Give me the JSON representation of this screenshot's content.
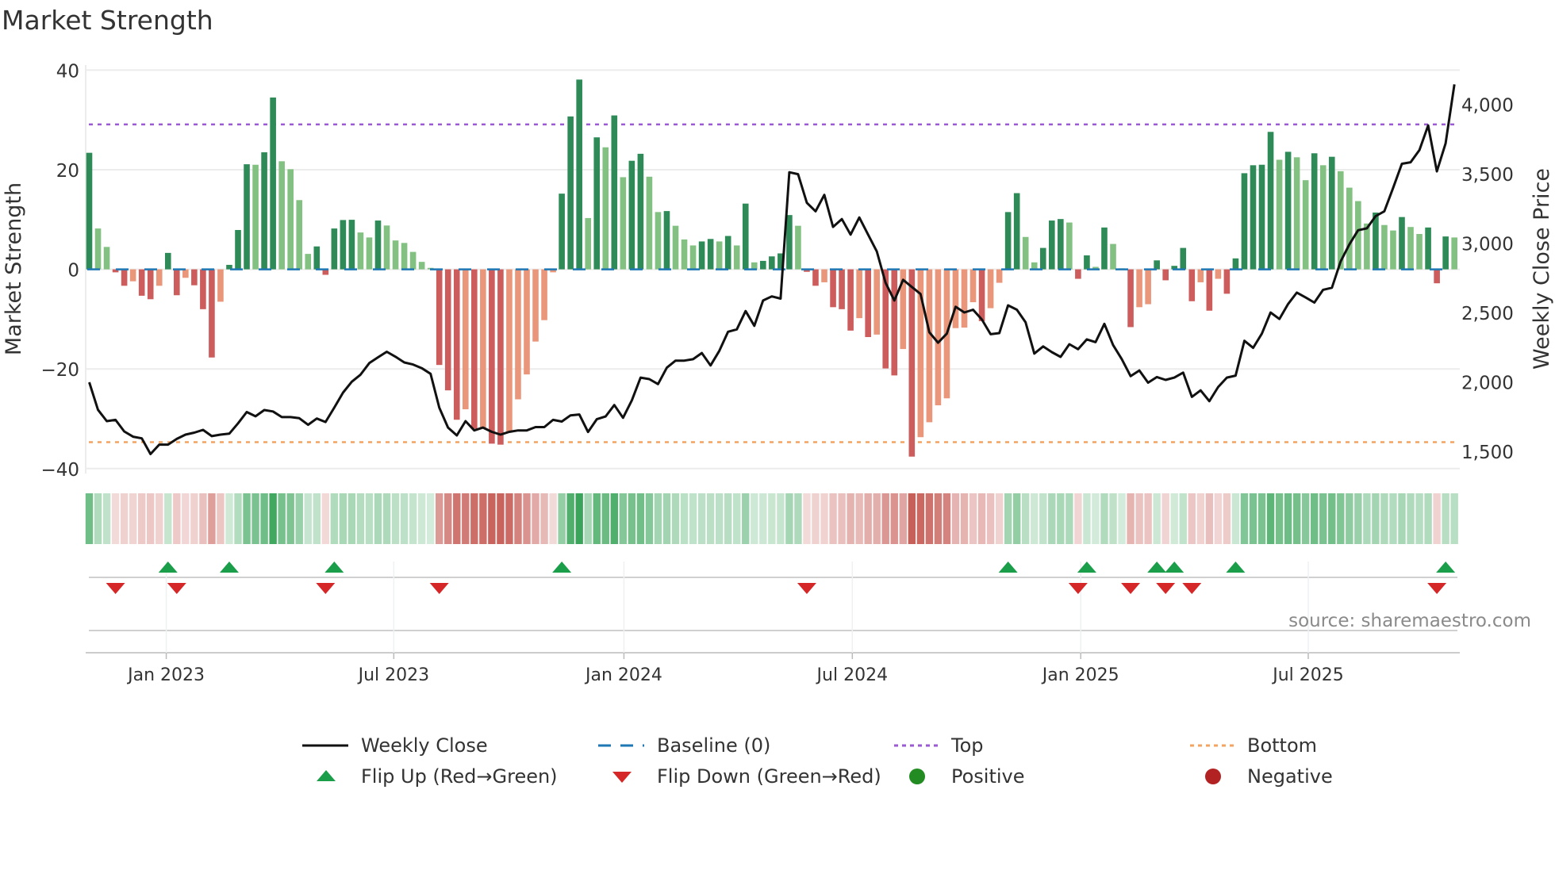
{
  "title": "Market Strength",
  "source": "source: sharemaestro.com",
  "colors": {
    "pos_dark": "#2e8b57",
    "pos_light": "#82c182",
    "neg_dark": "#cd5c5c",
    "neg_light": "#e9967a",
    "close": "#111111",
    "baseline": "#1f77b4",
    "top": "#9b59d6",
    "bottom": "#f4a460",
    "flip_up": "#1a9e4a",
    "flip_down": "#d62728",
    "positive": "#228b22",
    "negative": "#b22222",
    "strip_pos": "#3aa55a",
    "strip_neg": "#c8605a"
  },
  "legend": [
    {
      "label": "Weekly Close",
      "kind": "line"
    },
    {
      "label": "Baseline (0)",
      "kind": "dash"
    },
    {
      "label": "Top",
      "kind": "dot-top"
    },
    {
      "label": "Bottom",
      "kind": "dot-bottom"
    },
    {
      "label": "Flip Up (Red→Green)",
      "kind": "tri-up"
    },
    {
      "label": "Flip Down (Green→Red)",
      "kind": "tri-down"
    },
    {
      "label": "Positive",
      "kind": "dot-pos"
    },
    {
      "label": "Negative",
      "kind": "dot-neg"
    }
  ],
  "chart_data": {
    "type": "bar",
    "title": "Market Strength",
    "xlabel": "",
    "ylabel": "Market Strength",
    "ylabel_right": "Weekly Close Price",
    "ylim": [
      -40,
      40
    ],
    "ylim_right": [
      1500,
      4000
    ],
    "yticks": [
      "40",
      "20",
      "0",
      "−20",
      "−40"
    ],
    "ytick_values": [
      40,
      20,
      0,
      -20,
      -40
    ],
    "yticks_right": [
      "4,000",
      "3,500",
      "3,000",
      "2,500",
      "2,000",
      "1,500"
    ],
    "ytick_right_values": [
      4000,
      3500,
      3000,
      2500,
      2000,
      1500
    ],
    "x_unit": "week index (weekly bars, ~Nov 2022 to Oct 2025)",
    "xticks": [
      {
        "label": "Jan 2023",
        "week": 8.8
      },
      {
        "label": "Jul 2023",
        "week": 34.8
      },
      {
        "label": "Jan 2024",
        "week": 61.1
      },
      {
        "label": "Jul 2024",
        "week": 87.2
      },
      {
        "label": "Jan 2025",
        "week": 113.3
      },
      {
        "label": "Jul 2025",
        "week": 139.3
      }
    ],
    "top_level": 29.1,
    "bottom_level": -34.7,
    "baseline": 0,
    "series": [
      {
        "name": "Market Strength",
        "type": "bar",
        "values": [
          23.4,
          8.2,
          4.5,
          -0.6,
          -3.3,
          -2.4,
          -5.3,
          -6,
          -3.3,
          3.3,
          -5.2,
          -1.7,
          -3.2,
          -8,
          -17.7,
          -6.5,
          0.9,
          7.9,
          21.1,
          21,
          23.5,
          34.5,
          21.7,
          20.1,
          13.9,
          3.1,
          4.6,
          -1.1,
          8.2,
          9.9,
          9.95,
          7.4,
          6.4,
          9.8,
          8.8,
          5.8,
          5.3,
          3.5,
          1.5,
          0.3,
          -19.2,
          -24.3,
          -30.2,
          -28.1,
          -32,
          -31.9,
          -35,
          -35.2,
          -32.8,
          -26.1,
          -21.1,
          -14.5,
          -10.2,
          -0.6,
          15.2,
          30.7,
          38.1,
          10.3,
          26.5,
          24.5,
          30.9,
          18.5,
          21.8,
          23.2,
          18.6,
          11.5,
          11.7,
          8.75,
          6.0,
          4.8,
          5.6,
          6.1,
          5.6,
          6.7,
          4.8,
          13.2,
          1.4,
          1.7,
          2.6,
          3.2,
          10.9,
          8.75,
          -0.5,
          -3.3,
          -2.6,
          -7.6,
          -8,
          -12.3,
          -9.8,
          -13.6,
          -13.1,
          -19.9,
          -21.3,
          -16,
          -37.6,
          -33.7,
          -30.7,
          -27.3,
          -25.9,
          -11.8,
          -11.7,
          -6.6,
          -10.4,
          -7.8,
          -2.7,
          11.5,
          15.3,
          6.5,
          1.4,
          4.3,
          9.8,
          10.1,
          9.4,
          -1.9,
          2.8,
          0.5,
          8.4,
          5.1,
          0.2,
          -11.6,
          -7.6,
          -7,
          1.8,
          -2.2,
          0.7,
          4.3,
          -6.4,
          -2.6,
          -8.3,
          -1.9,
          -4.9,
          2.2,
          19.3,
          20.9,
          21,
          27.6,
          22,
          23.6,
          22.5,
          17.9,
          23.3,
          20.9,
          22.6,
          19.7,
          16.4,
          13.7,
          9.2,
          11.4,
          8.9,
          7.8,
          10.5,
          8.5,
          7.1,
          8.4,
          -2.8,
          6.6,
          6.4
        ]
      },
      {
        "name": "Weekly Close",
        "type": "line",
        "axis": "right",
        "values": [
          1997,
          1799,
          1717,
          1726,
          1643,
          1605,
          1593,
          1480,
          1548,
          1548,
          1589,
          1620,
          1634,
          1654,
          1609,
          1620,
          1627,
          1701,
          1783,
          1752,
          1797,
          1787,
          1746,
          1746,
          1738,
          1691,
          1736,
          1711,
          1814,
          1923,
          2001,
          2052,
          2135,
          2177,
          2217,
          2181,
          2140,
          2125,
          2099,
          2058,
          1814,
          1671,
          1614,
          1717,
          1650,
          1671,
          1640,
          1620,
          1640,
          1650,
          1650,
          1674,
          1674,
          1726,
          1714,
          1759,
          1765,
          1639,
          1731,
          1751,
          1833,
          1741,
          1867,
          2031,
          2020,
          1984,
          2102,
          2153,
          2153,
          2163,
          2208,
          2118,
          2224,
          2361,
          2378,
          2510,
          2404,
          2586,
          2616,
          2600,
          3510,
          3496,
          3290,
          3229,
          3347,
          3116,
          3173,
          3061,
          3184,
          3061,
          2939,
          2714,
          2586,
          2735,
          2684,
          2633,
          2357,
          2282,
          2347,
          2541,
          2500,
          2520,
          2449,
          2343,
          2351,
          2551,
          2520,
          2429,
          2204,
          2255,
          2214,
          2180,
          2271,
          2235,
          2306,
          2286,
          2418,
          2265,
          2163,
          2041,
          2082,
          1994,
          2035,
          2014,
          2031,
          2067,
          1892,
          1939,
          1861,
          1963,
          2031,
          2045,
          2296,
          2245,
          2347,
          2500,
          2453,
          2561,
          2643,
          2608,
          2571,
          2663,
          2678,
          2867,
          2990,
          3092,
          3106,
          3194,
          3229,
          3398,
          3571,
          3582,
          3669,
          3847,
          3516,
          3718,
          4143
        ]
      }
    ],
    "legend_position": "bottom-center",
    "grid": true
  }
}
